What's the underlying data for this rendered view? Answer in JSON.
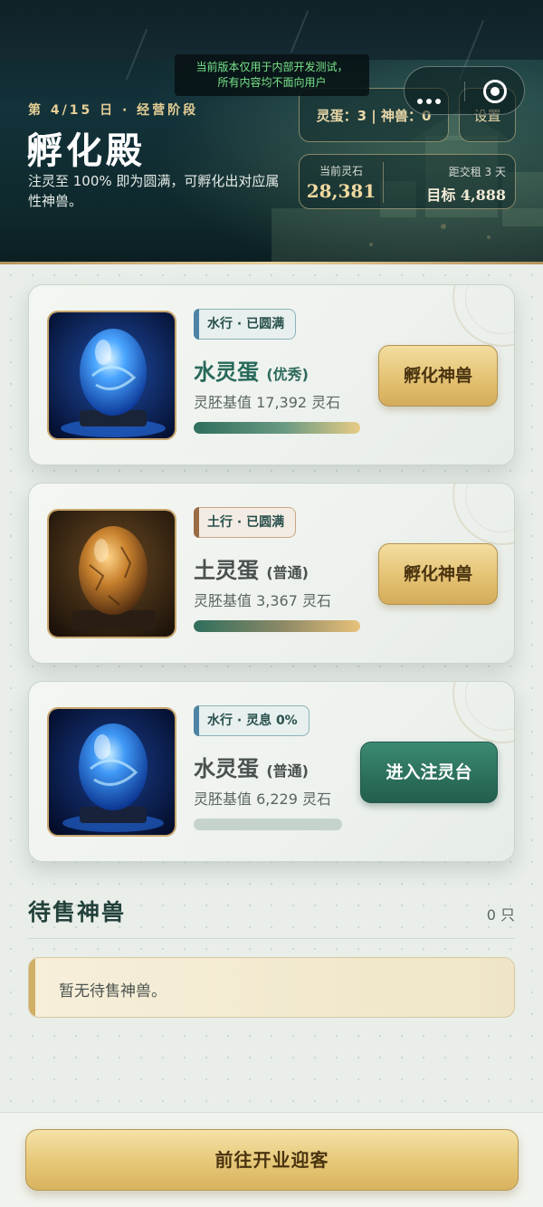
{
  "notice": {
    "line1": "当前版本仅用于内部开发测试，",
    "line2": "所有内容均不面向用户"
  },
  "header": {
    "day_label": "第 4/15 日 · 经营阶段",
    "title": "孵化殿",
    "description": "注灵至 100% 即为圆满，可孵化出对应属性神兽。",
    "stats": "灵蛋：3 | 神兽：0",
    "settings_label": "设置",
    "stone_label": "当前灵石",
    "stone_value": "28,381",
    "rent_label": "距交租 3 天",
    "target_label": "目标 4,888"
  },
  "eggs": [
    {
      "tag": "水行 · 已圆满",
      "name": "水灵蛋",
      "grade": "(优秀)",
      "value": "灵胚基值 17,392 灵石",
      "progress": 1.0,
      "action": "孵化神兽",
      "element": "water"
    },
    {
      "tag": "土行 · 已圆满",
      "name": "土灵蛋",
      "grade": "(普通)",
      "value": "灵胚基值 3,367 灵石",
      "progress": 1.0,
      "action": "孵化神兽",
      "element": "earth"
    },
    {
      "tag": "水行 · 灵息 0%",
      "name": "水灵蛋",
      "grade": "(普通)",
      "value": "灵胚基值 6,229 灵石",
      "progress": 0.0,
      "action": "进入注灵台",
      "element": "water"
    }
  ],
  "sale": {
    "title": "待售神兽",
    "count": "0 只",
    "empty_text": "暂无待售神兽。"
  },
  "footer": {
    "button_label": "前往开业迎客"
  },
  "colors": {
    "accent_gold": "#e3c070",
    "accent_teal": "#2b6f5b",
    "hero_bg": "#13323a"
  }
}
